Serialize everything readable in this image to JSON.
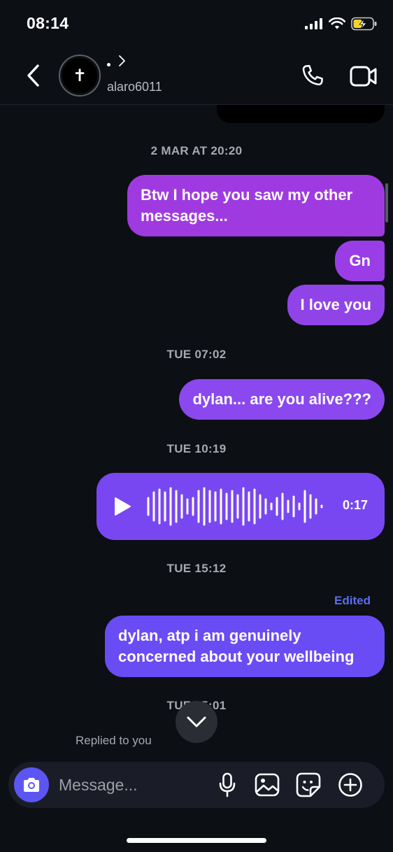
{
  "status_bar": {
    "time": "08:14"
  },
  "header": {
    "username": "alaro6011",
    "avatar_symbol": "✝"
  },
  "messages": {
    "timestamps": [
      "2 MAR AT 20:20",
      "TUE 07:02",
      "TUE 10:19",
      "TUE 15:12",
      "TUE 15:01"
    ],
    "bubbles": [
      "Btw I hope you saw my other messages...",
      "Gn",
      "I love you",
      "dylan... are you alive???",
      "dylan, atp i am genuinely concerned about your wellbeing"
    ],
    "voice_duration": "0:17",
    "edited_label": "Edited",
    "replied_label": "Replied to you"
  },
  "composer": {
    "placeholder": "Message..."
  },
  "colors": {
    "background": "#0c0f14",
    "bubble_start": "#9f3ae0",
    "bubble_end": "#6a4cf4",
    "accent": "#5b56f2",
    "edited": "#5b6df0"
  },
  "icons": [
    "back-chevron-icon",
    "chevron-right-icon",
    "phone-icon",
    "video-camera-icon",
    "play-icon",
    "chevron-down-icon",
    "camera-icon",
    "microphone-icon",
    "gallery-icon",
    "sticker-icon",
    "plus-circle-icon",
    "signal-icon",
    "wifi-icon",
    "battery-charging-icon"
  ]
}
